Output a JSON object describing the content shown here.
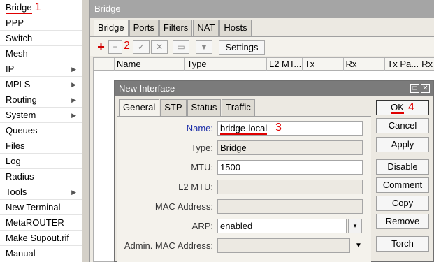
{
  "left_menu": {
    "items": [
      {
        "label": "Bridge",
        "annotation": "1",
        "arrow": false
      },
      {
        "label": "PPP",
        "arrow": false
      },
      {
        "label": "Switch",
        "arrow": false
      },
      {
        "label": "Mesh",
        "arrow": false
      },
      {
        "label": "IP",
        "arrow": true
      },
      {
        "label": "MPLS",
        "arrow": true
      },
      {
        "label": "Routing",
        "arrow": true
      },
      {
        "label": "System",
        "arrow": true
      },
      {
        "label": "Queues",
        "arrow": false
      },
      {
        "label": "Files",
        "arrow": false
      },
      {
        "label": "Log",
        "arrow": false
      },
      {
        "label": "Radius",
        "arrow": false
      },
      {
        "label": "Tools",
        "arrow": true
      },
      {
        "label": "New Terminal",
        "arrow": false
      },
      {
        "label": "MetaROUTER",
        "arrow": false
      },
      {
        "label": "Make Supout.rif",
        "arrow": false
      },
      {
        "label": "Manual",
        "arrow": false
      }
    ]
  },
  "bridge_window": {
    "title": "Bridge",
    "tabs": [
      "Bridge",
      "Ports",
      "Filters",
      "NAT",
      "Hosts"
    ],
    "active_tab": "Bridge",
    "toolbar": {
      "add_symbol": "+",
      "remove_symbol": "−",
      "enable_symbol": "✓",
      "disable_symbol": "✕",
      "comment_symbol": "▭",
      "filter_symbol": "▼",
      "add_annotation": "2",
      "settings_label": "Settings"
    },
    "table_columns": [
      "",
      "Name",
      "Type",
      "L2 MT...",
      "Tx",
      "Rx",
      "Tx Pa...",
      "Rx"
    ]
  },
  "dialog": {
    "title": "New Interface",
    "maximize_symbol": "□",
    "close_symbol": "✕",
    "tabs": [
      "General",
      "STP",
      "Status",
      "Traffic"
    ],
    "active_tab": "General",
    "fields": {
      "name": {
        "label": "Name:",
        "value": "bridge-local",
        "annotation": "3"
      },
      "type": {
        "label": "Type:",
        "value": "Bridge"
      },
      "mtu": {
        "label": "MTU:",
        "value": "1500"
      },
      "l2mtu": {
        "label": "L2 MTU:",
        "value": ""
      },
      "mac": {
        "label": "MAC Address:",
        "value": ""
      },
      "arp": {
        "label": "ARP:",
        "value": "enabled",
        "dropdown_symbol": "▾"
      },
      "admin_mac": {
        "label": "Admin. MAC Address:",
        "value": "",
        "dropdown_symbol": "▼"
      }
    },
    "buttons": {
      "ok": "OK",
      "ok_annotation": "4",
      "cancel": "Cancel",
      "apply": "Apply",
      "disable": "Disable",
      "comment": "Comment",
      "copy": "Copy",
      "remove": "Remove",
      "torch": "Torch"
    }
  },
  "colors": {
    "annotation_red": "#e00000",
    "blue_label": "#1d2fa8",
    "title_bar_gray": "#a5a5a5",
    "dialog_title_gray": "#7b7b7b"
  }
}
